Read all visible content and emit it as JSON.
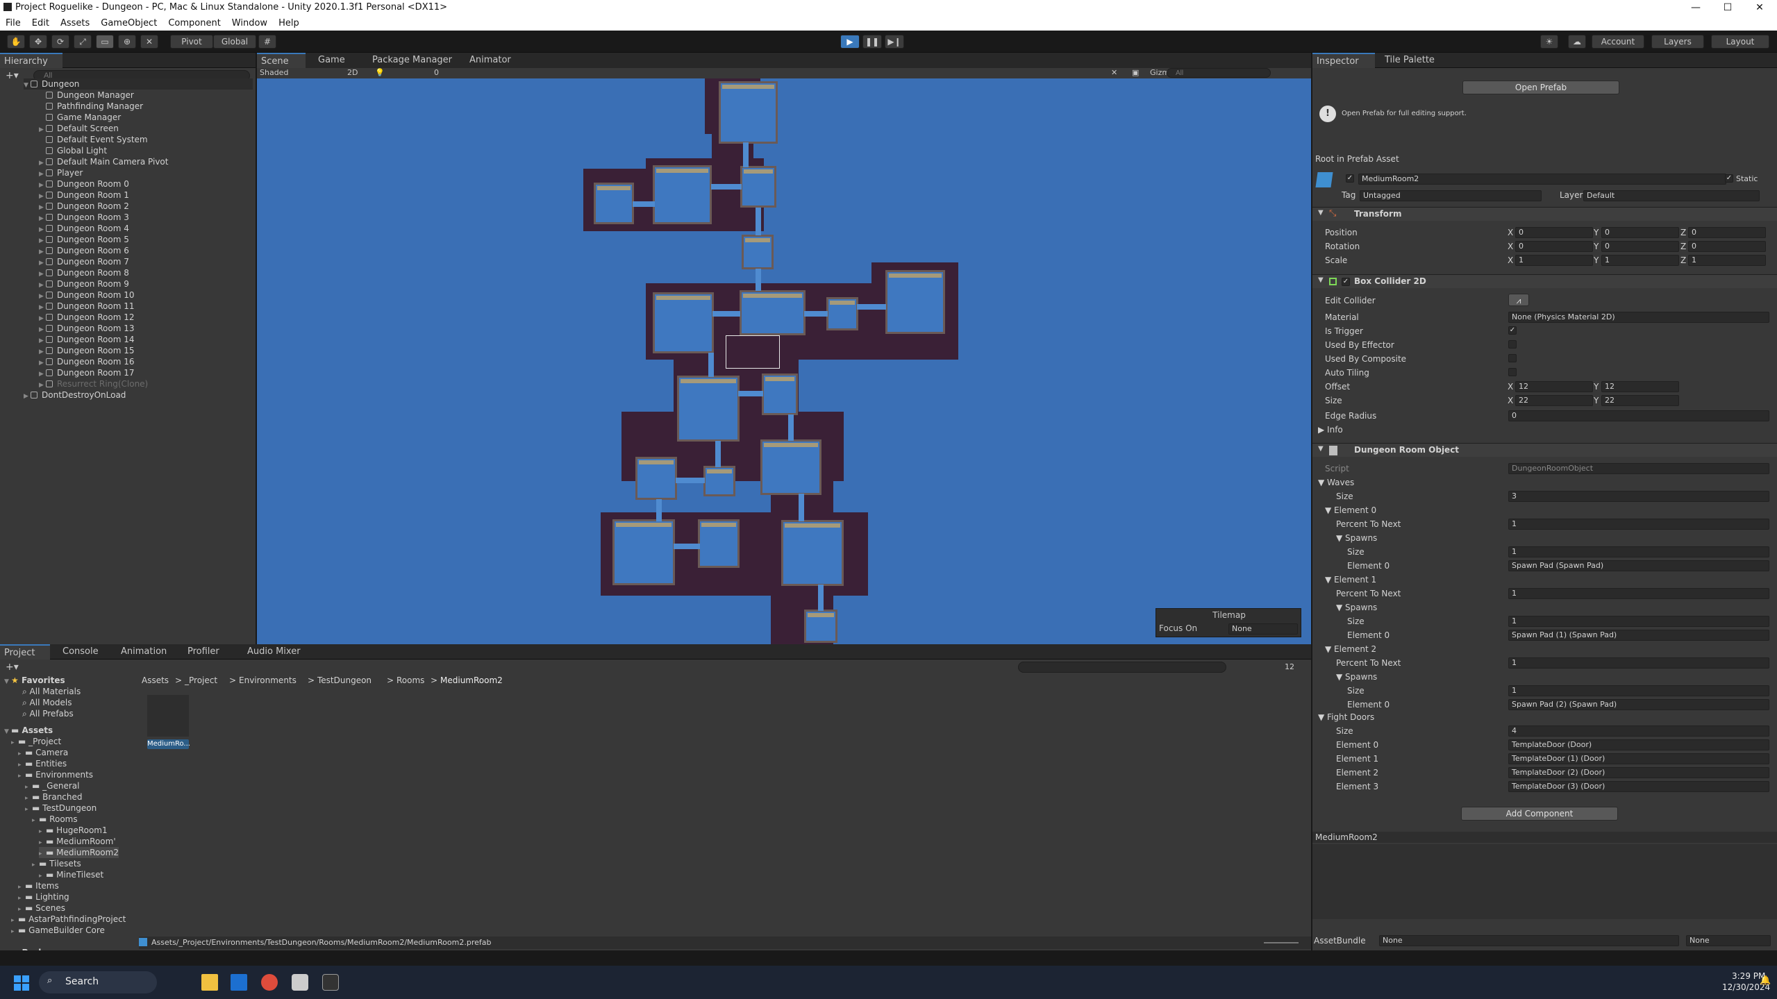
{
  "title_bar": {
    "title": "Project Roguelike - Dungeon - PC, Mac & Linux Standalone - Unity 2020.1.3f1 Personal <DX11>",
    "minimize": "—",
    "maximize": "☐",
    "close": "✕"
  },
  "menu": [
    "File",
    "Edit",
    "Assets",
    "GameObject",
    "Component",
    "Window",
    "Help"
  ],
  "toolbar": {
    "pivot": "Pivot",
    "global": "Global",
    "account": "Account",
    "layers": "Layers",
    "layout": "Layout"
  },
  "hierarchy": {
    "tab": "Hierarchy",
    "search_placeholder": "All",
    "scene_root": "Dungeon",
    "items": [
      "Dungeon Manager",
      "Pathfinding Manager",
      "Game Manager",
      "Default Screen",
      "Default Event System",
      "Global Light",
      "Default Main Camera Pivot",
      "Player",
      "Dungeon Room 0",
      "Dungeon Room 1",
      "Dungeon Room 2",
      "Dungeon Room 3",
      "Dungeon Room 4",
      "Dungeon Room 5",
      "Dungeon Room 6",
      "Dungeon Room 7",
      "Dungeon Room 8",
      "Dungeon Room 9",
      "Dungeon Room 10",
      "Dungeon Room 11",
      "Dungeon Room 12",
      "Dungeon Room 13",
      "Dungeon Room 14",
      "Dungeon Room 15",
      "Dungeon Room 16",
      "Dungeon Room 17",
      "Resurrect Ring(Clone)"
    ],
    "dont_destroy": "DontDestroyOnLoad"
  },
  "scene_tabs": [
    "Scene",
    "Game",
    "Package Manager",
    "Animator"
  ],
  "scene_toolbar": {
    "shading": "Shaded",
    "mode_2d": "2D",
    "gizmos": "Gizmos",
    "search_placeholder": "All",
    "hidden_count": "0"
  },
  "tilemap_overlay": {
    "title": "Tilemap",
    "focus_label": "Focus On",
    "focus_value": "None"
  },
  "inspector": {
    "tabs": [
      "Inspector",
      "Tile Palette"
    ],
    "open_prefab": "Open Prefab",
    "info": "Open Prefab for full editing support.",
    "root_label": "Root in Prefab Asset",
    "object_name": "MediumRoom2",
    "static": "Static",
    "tag_label": "Tag",
    "tag_value": "Untagged",
    "layer_label": "Layer",
    "layer_value": "Default",
    "transform": {
      "header": "Transform",
      "position_label": "Position",
      "position": [
        "0",
        "0",
        "0"
      ],
      "rotation_label": "Rotation",
      "rotation": [
        "0",
        "0",
        "0"
      ],
      "scale_label": "Scale",
      "scale": [
        "1",
        "1",
        "1"
      ]
    },
    "box_collider": {
      "header": "Box Collider 2D",
      "edit_collider": "Edit Collider",
      "material_label": "Material",
      "material_value": "None (Physics Material 2D)",
      "is_trigger": "Is Trigger",
      "used_by_effector": "Used By Effector",
      "used_by_composite": "Used By Composite",
      "auto_tiling": "Auto Tiling",
      "offset_label": "Offset",
      "offset": [
        "12",
        "12"
      ],
      "size_label": "Size",
      "size": [
        "22",
        "22"
      ],
      "edge_radius_label": "Edge Radius",
      "edge_radius": "0",
      "info": "Info"
    },
    "dungeon_room": {
      "header": "Dungeon Room Object",
      "script_label": "Script",
      "script_value": "DungeonRoomObject",
      "waves": "Waves",
      "size_label": "Size",
      "waves_size": "3",
      "elements": [
        {
          "name": "Element 0",
          "percent_label": "Percent To Next",
          "percent": "1",
          "spawns": "Spawns",
          "spawn_size": "1",
          "spawn_element": "Element 0",
          "spawn_value": "Spawn Pad (Spawn Pad)"
        },
        {
          "name": "Element 1",
          "percent_label": "Percent To Next",
          "percent": "1",
          "spawns": "Spawns",
          "spawn_size": "1",
          "spawn_element": "Element 0",
          "spawn_value": "Spawn Pad (1) (Spawn Pad)"
        },
        {
          "name": "Element 2",
          "percent_label": "Percent To Next",
          "percent": "1",
          "spawns": "Spawns",
          "spawn_size": "1",
          "spawn_element": "Element 0",
          "spawn_value": "Spawn Pad (2) (Spawn Pad)"
        }
      ],
      "fight_doors": "Fight Doors",
      "fight_doors_size": "4",
      "doors": [
        {
          "label": "Element 0",
          "value": "TemplateDoor (Door)"
        },
        {
          "label": "Element 1",
          "value": "TemplateDoor (1) (Door)"
        },
        {
          "label": "Element 2",
          "value": "TemplateDoor (2) (Door)"
        },
        {
          "label": "Element 3",
          "value": "TemplateDoor (3) (Door)"
        }
      ]
    },
    "add_component": "Add Component",
    "preview_title": "MediumRoom2",
    "assetbundle_label": "AssetBundle",
    "assetbundle_value": "None",
    "assetbundle_variant": "None"
  },
  "bottom_tabs": [
    "Project",
    "Console",
    "Animation",
    "Profiler",
    "Audio Mixer"
  ],
  "project": {
    "favorites": "Favorites",
    "fav_items": [
      "All Materials",
      "All Models",
      "All Prefabs"
    ],
    "assets": "Assets",
    "tree": [
      {
        "label": "_Project",
        "depth": 1
      },
      {
        "label": "Camera",
        "depth": 2
      },
      {
        "label": "Entities",
        "depth": 2
      },
      {
        "label": "Environments",
        "depth": 2
      },
      {
        "label": "_General",
        "depth": 3
      },
      {
        "label": "Branched",
        "depth": 3
      },
      {
        "label": "TestDungeon",
        "depth": 3
      },
      {
        "label": "Rooms",
        "depth": 4
      },
      {
        "label": "HugeRoom1",
        "depth": 5
      },
      {
        "label": "MediumRoom'",
        "depth": 5
      },
      {
        "label": "MediumRoom2",
        "depth": 5
      },
      {
        "label": "Tilesets",
        "depth": 4
      },
      {
        "label": "MineTileset",
        "depth": 5
      },
      {
        "label": "Items",
        "depth": 2
      },
      {
        "label": "Lighting",
        "depth": 2
      },
      {
        "label": "Scenes",
        "depth": 2
      },
      {
        "label": "AstarPathfindingProject",
        "depth": 1
      },
      {
        "label": "GameBuilder Core",
        "depth": 1
      }
    ],
    "packages": "Packages",
    "breadcrumb": [
      "Assets",
      "_Project",
      "Environments",
      "TestDungeon",
      "Rooms",
      "MediumRoom2"
    ],
    "asset_label": "MediumRo...",
    "status_path": "Assets/_Project/Environments/TestDungeon/Rooms/MediumRoom2/MediumRoom2.prefab",
    "count_badge": "12"
  },
  "taskbar": {
    "search": "Search",
    "time": "3:29 PM",
    "date": "12/30/2024"
  }
}
